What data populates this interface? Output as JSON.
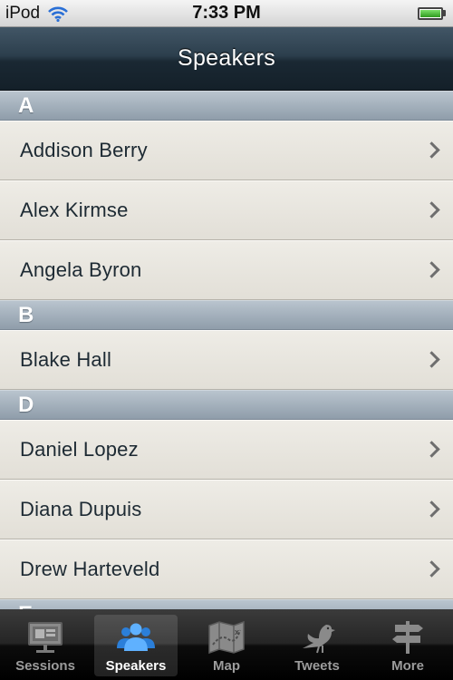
{
  "status_bar": {
    "carrier": "iPod",
    "time": "7:33 PM"
  },
  "nav": {
    "title": "Speakers"
  },
  "sections": [
    {
      "letter": "A",
      "items": [
        "Addison Berry",
        "Alex Kirmse",
        "Angela Byron"
      ]
    },
    {
      "letter": "B",
      "items": [
        "Blake Hall"
      ]
    },
    {
      "letter": "D",
      "items": [
        "Daniel Lopez",
        "Diana Dupuis",
        "Drew Harteveld"
      ]
    },
    {
      "letter": "E",
      "items": []
    }
  ],
  "tabs": [
    {
      "label": "Sessions",
      "icon": "presentation-board-icon",
      "active": false
    },
    {
      "label": "Speakers",
      "icon": "people-icon",
      "active": true
    },
    {
      "label": "Map",
      "icon": "map-icon",
      "active": false
    },
    {
      "label": "Tweets",
      "icon": "bird-icon",
      "active": false
    },
    {
      "label": "More",
      "icon": "signpost-icon",
      "active": false
    }
  ],
  "colors": {
    "nav_bg": "#1a2833",
    "section_header": "#8f9daa",
    "tab_active": "#3a8fe0"
  }
}
